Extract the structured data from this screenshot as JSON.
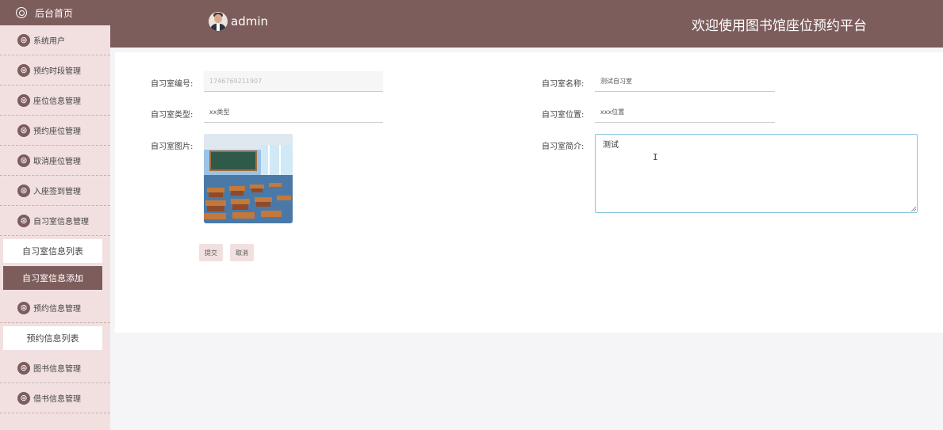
{
  "sidebar": {
    "home_label": "后台首页",
    "items": [
      {
        "label": "系统用户"
      },
      {
        "label": "预约时段管理"
      },
      {
        "label": "座位信息管理"
      },
      {
        "label": "预约座位管理"
      },
      {
        "label": "取消座位管理"
      },
      {
        "label": "入座签到管理"
      },
      {
        "label": "自习室信息管理"
      }
    ],
    "subitems": [
      {
        "label": "自习室信息列表"
      },
      {
        "label": "自习室信息添加"
      }
    ],
    "items2": [
      {
        "label": "预约信息管理"
      }
    ],
    "subitems2": [
      {
        "label": "预约信息列表"
      }
    ],
    "items3": [
      {
        "label": "图书信息管理"
      },
      {
        "label": "借书信息管理"
      }
    ]
  },
  "header": {
    "username": "admin",
    "title": "欢迎使用图书馆座位预约平台",
    "brand_color": "#7d5c5c"
  },
  "form": {
    "room_no_label": "自习室编号:",
    "room_no_value": "1746769211907",
    "room_name_label": "自习室名称:",
    "room_name_value": "测试自习室",
    "room_type_label": "自习室类型:",
    "room_type_value": "xx类型",
    "room_location_label": "自习室位置:",
    "room_location_value": "xxx位置",
    "room_image_label": "自习室图片:",
    "room_intro_label": "自习室简介:",
    "room_intro_value": "测试",
    "submit_label": "提交",
    "cancel_label": "取消"
  }
}
